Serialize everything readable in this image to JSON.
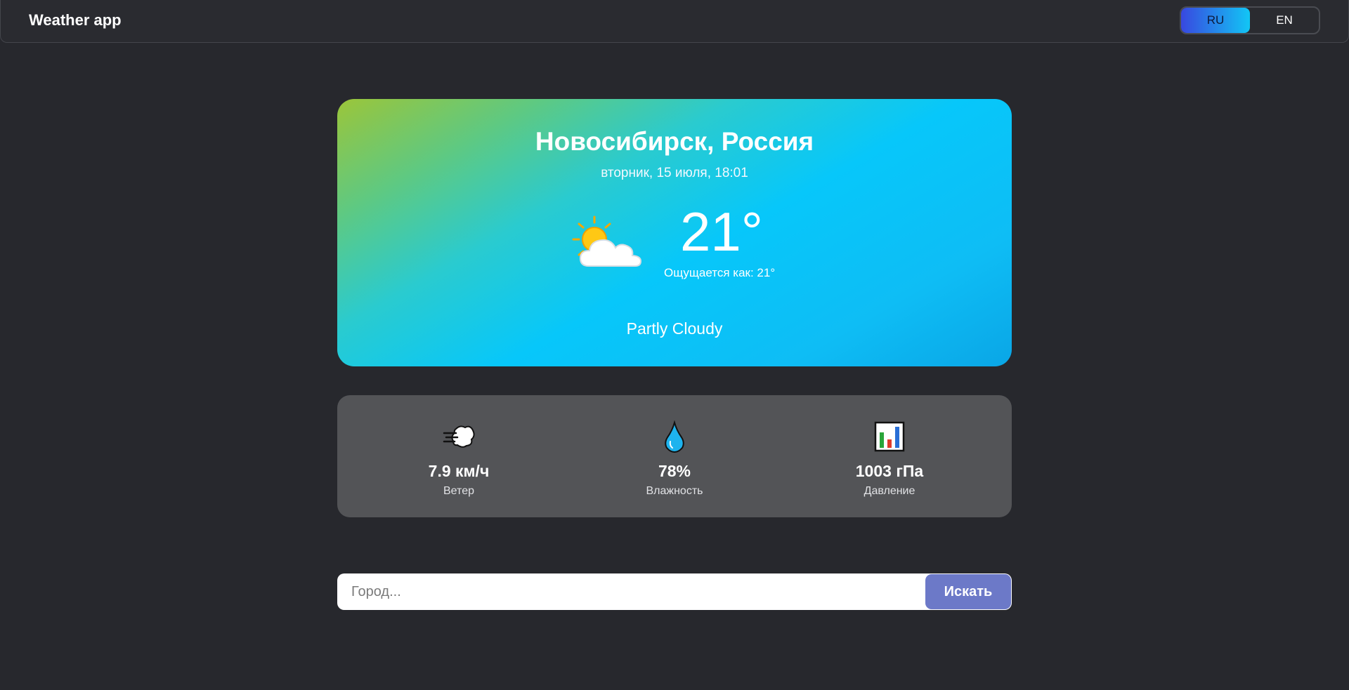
{
  "header": {
    "title": "Weather app",
    "languages": [
      {
        "label": "RU",
        "active": true
      },
      {
        "label": "EN",
        "active": false
      }
    ]
  },
  "weather": {
    "city": "Новосибирск, Россия",
    "datetime": "вторник, 15 июля, 18:01",
    "icon": "partly-cloudy-icon",
    "temperature": "21°",
    "feels_like": "Ощущается как: 21°",
    "condition": "Partly Cloudy"
  },
  "stats": [
    {
      "icon": "wind-icon",
      "value": "7.9 км/ч",
      "label": "Ветер"
    },
    {
      "icon": "droplet-icon",
      "value": "78%",
      "label": "Влажность"
    },
    {
      "icon": "bar-chart-icon",
      "value": "1003 гПа",
      "label": "Давление"
    }
  ],
  "search": {
    "placeholder": "Город...",
    "value": "",
    "button_label": "Искать"
  },
  "colors": {
    "background": "#27282d",
    "stats_card": "#535457",
    "search_button": "#6c79c8",
    "lang_active_start": "#3848e0",
    "lang_active_end": "#12c6f5"
  }
}
